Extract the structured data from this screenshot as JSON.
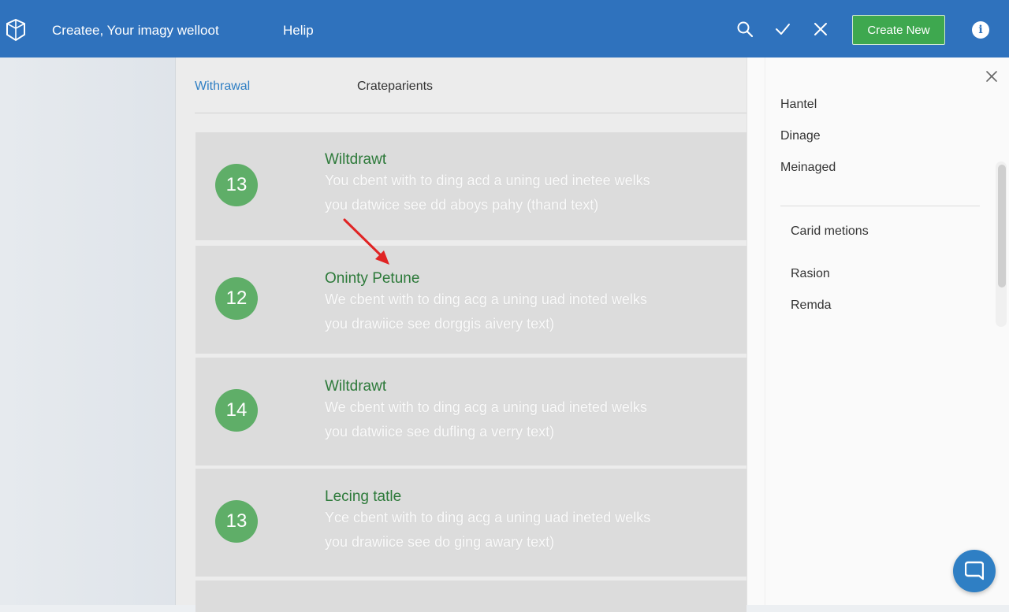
{
  "header": {
    "app_title": "Createe, Your imagy welloot",
    "help_label": "Helip",
    "create_new_label": "Create New",
    "info_glyph": "i",
    "icons": [
      "logo-icon",
      "search-icon",
      "check-icon",
      "close-icon",
      "info-icon"
    ]
  },
  "tabs": [
    {
      "label": "Withrawal",
      "active": true
    },
    {
      "label": "Crateparients",
      "active": false
    }
  ],
  "cards": [
    {
      "badge": "13",
      "title": "Wiltdrawt",
      "line1": "You cbent with to ding acd a uning ued inetee welks",
      "line2": "you datwice see dd aboys pahy (thand text)"
    },
    {
      "badge": "12",
      "title": "Oninty Petune",
      "line1": "We cbent with to ding acg a uning uad inoted welks",
      "line2": "you drawiice see dorggis aivery text)"
    },
    {
      "badge": "14",
      "title": "Wiltdrawt",
      "line1": "We cbent with to ding acg a uning uad ineted welks",
      "line2": "you datwiice see dufling a verry text)"
    },
    {
      "badge": "13",
      "title": "Lecing tatle",
      "line1": "Yce cbent with to ding acg a uning uad ineted welks",
      "line2": "you drawiice see do ging awary text)"
    }
  ],
  "right_panel": {
    "items_top": [
      "Hantel",
      "Dinage",
      "Meinaged"
    ],
    "items_bottom": [
      "Carid metions",
      "Rasion",
      "Remda"
    ]
  },
  "colors": {
    "header_bg": "#2f72bd",
    "create_button": "#3ea84f",
    "badge": "#5fae68",
    "card_title": "#2d7a3a",
    "active_tab": "#2f7fc4",
    "annotation_arrow": "#e02424"
  }
}
